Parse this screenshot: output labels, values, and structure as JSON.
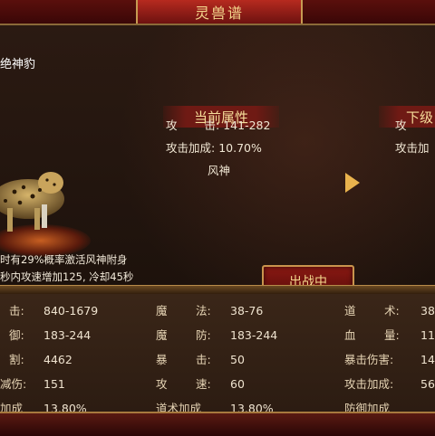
{
  "window": {
    "title": "灵兽谱"
  },
  "beast": {
    "name": "绝神豹",
    "skill_line1": "时有29%概率激活风神附身",
    "skill_line2": "秒内攻速增加125, 冷却45秒"
  },
  "current": {
    "header": "当前属性",
    "attack_label": "攻",
    "attack_label2": "击:",
    "attack_value": "141-282",
    "bonus_label": "攻击加成:",
    "bonus_value": "10.70%",
    "element": "风神"
  },
  "next": {
    "header": "下级",
    "attack_label": "攻",
    "bonus_label": "攻击加"
  },
  "battle_button": {
    "label": "出战中"
  },
  "stats": {
    "col1": [
      {
        "label": "击:",
        "value": "840-1679"
      },
      {
        "label": "御:",
        "value": "183-244"
      },
      {
        "label": "割:",
        "value": "4462"
      },
      {
        "label": "减伤:",
        "value": "151"
      },
      {
        "label": "加成",
        "value": "13.80%"
      }
    ],
    "col2": [
      {
        "label": "魔",
        "label2": "法:",
        "value": "38-76"
      },
      {
        "label": "魔",
        "label2": "防:",
        "value": "183-244"
      },
      {
        "label": "暴",
        "label2": "击:",
        "value": "50"
      },
      {
        "label": "攻",
        "label2": "速:",
        "value": "60"
      },
      {
        "label": "道术加成",
        "label2": "",
        "value": "13.80%"
      }
    ],
    "col3": [
      {
        "label": "道",
        "label2": "术:",
        "value": "38"
      },
      {
        "label": "血",
        "label2": "量:",
        "value": "11"
      },
      {
        "label": "暴击伤害:",
        "label2": "",
        "value": "14"
      },
      {
        "label": "攻击加成:",
        "label2": "",
        "value": "56"
      },
      {
        "label": "防御加成",
        "label2": "",
        "value": ""
      }
    ]
  },
  "colors": {
    "accent_gold": "#f4d78d",
    "banner_red": "#6f1a14",
    "button_red": "#8a1913"
  }
}
